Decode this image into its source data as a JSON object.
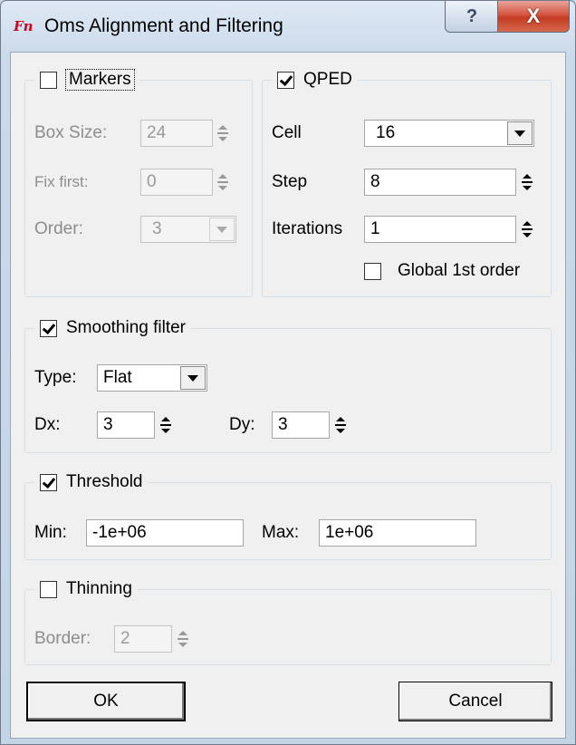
{
  "window": {
    "title": "Oms Alignment and Filtering",
    "icon_text": "Fn",
    "help_glyph": "?",
    "close_glyph": "X"
  },
  "markers": {
    "label": "Markers",
    "checked": false,
    "box_size_label": "Box Size:",
    "box_size_value": "24",
    "fix_first_label": "Fix first:",
    "fix_first_value": "0",
    "order_label": "Order:",
    "order_value": "3"
  },
  "qped": {
    "label": "QPED",
    "checked": true,
    "cell_label": "Cell",
    "cell_value": "16",
    "step_label": "Step",
    "step_value": "8",
    "iterations_label": "Iterations",
    "iterations_value": "1",
    "global_label": "Global 1st order",
    "global_checked": false
  },
  "smoothing": {
    "label": "Smoothing filter",
    "checked": true,
    "type_label": "Type:",
    "type_value": "Flat",
    "dx_label": "Dx:",
    "dx_value": "3",
    "dy_label": "Dy:",
    "dy_value": "3"
  },
  "threshold": {
    "label": "Threshold",
    "checked": true,
    "min_label": "Min:",
    "min_value": "-1e+06",
    "max_label": "Max:",
    "max_value": "1e+06"
  },
  "thinning": {
    "label": "Thinning",
    "checked": false,
    "border_label": "Border:",
    "border_value": "2"
  },
  "buttons": {
    "ok": "OK",
    "cancel": "Cancel"
  }
}
